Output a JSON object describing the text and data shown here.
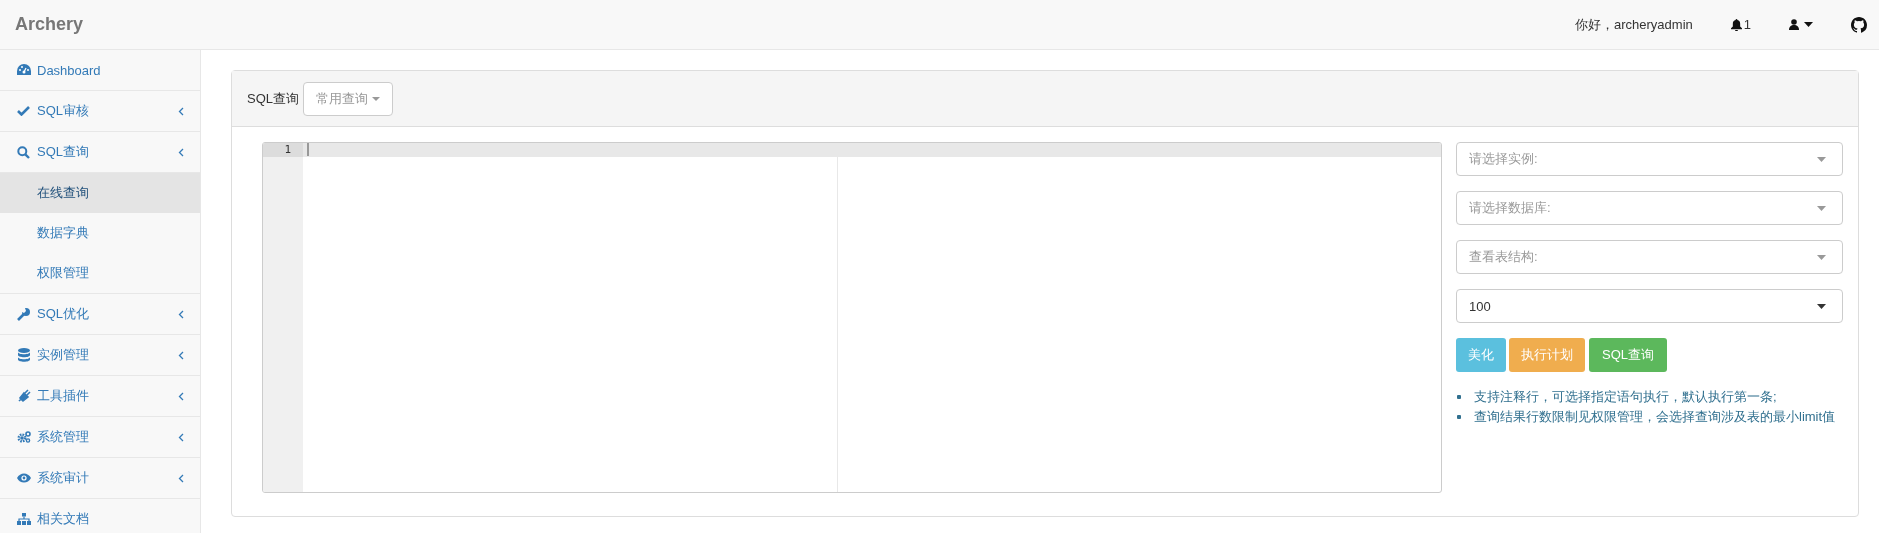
{
  "navbar": {
    "brand": "Archery",
    "greeting": "你好，archeryadmin",
    "notification_count": "1"
  },
  "sidebar": {
    "items": [
      {
        "label": "Dashboard",
        "kind": "link",
        "selected": false
      },
      {
        "label": "SQL审核",
        "kind": "menu",
        "selected": false
      },
      {
        "label": "SQL查询",
        "kind": "menu",
        "selected": false,
        "children": [
          {
            "label": "在线查询",
            "selected": true
          },
          {
            "label": "数据字典",
            "selected": false
          },
          {
            "label": "权限管理",
            "selected": false
          }
        ]
      },
      {
        "label": "SQL优化",
        "kind": "menu",
        "selected": false
      },
      {
        "label": "实例管理",
        "kind": "menu",
        "selected": false
      },
      {
        "label": "工具插件",
        "kind": "menu",
        "selected": false
      },
      {
        "label": "系统管理",
        "kind": "menu",
        "selected": false
      },
      {
        "label": "系统审计",
        "kind": "menu",
        "selected": false
      },
      {
        "label": "相关文档",
        "kind": "link",
        "selected": false
      }
    ]
  },
  "panel": {
    "title": "SQL查询",
    "saved_queries": "常用查询"
  },
  "editor": {
    "line_numbers": [
      "1"
    ]
  },
  "selects": [
    {
      "placeholder": "请选择实例:"
    },
    {
      "placeholder": "请选择数据库:"
    },
    {
      "placeholder": "查看表结构:"
    },
    {
      "value": "100"
    }
  ],
  "buttons": [
    {
      "label": "美化",
      "kind": "info"
    },
    {
      "label": "执行计划",
      "kind": "warning"
    },
    {
      "label": "SQL查询",
      "kind": "success"
    }
  ],
  "notes": [
    "支持注释行，可选择指定语句执行，默认执行第一条;",
    "查询结果行数限制见权限管理，会选择查询涉及表的最小limit值"
  ]
}
